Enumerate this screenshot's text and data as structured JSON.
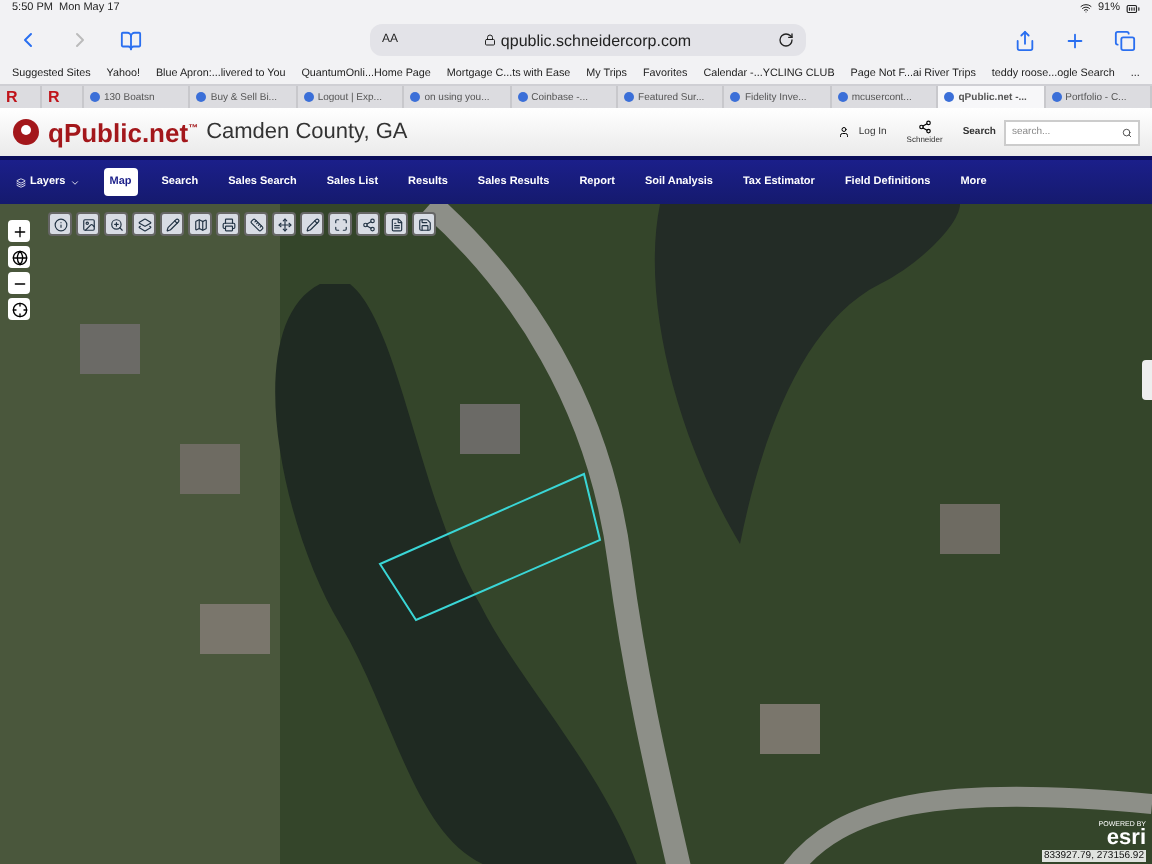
{
  "status_bar": {
    "time": "5:50 PM",
    "date": "Mon May 17",
    "battery": "91%"
  },
  "browser_toolbar": {
    "text_size": "AA",
    "url": "qpublic.schneidercorp.com"
  },
  "bookmarks": [
    "Suggested Sites",
    "Yahoo!",
    "Blue Apron:...livered to You",
    "QuantumOnli...Home Page",
    "Mortgage C...ts with Ease",
    "My Trips",
    "Favorites",
    "Calendar -...YCLING CLUB",
    "Page Not F...ai River Trips",
    "teddy roose...ogle Search",
    "..."
  ],
  "tabs": [
    {
      "kind": "pinned",
      "label": "R",
      "selected": false
    },
    {
      "kind": "pinned",
      "label": "R",
      "selected": false
    },
    {
      "kind": "tab",
      "label": "130 Boatsn",
      "selected": false
    },
    {
      "kind": "tab",
      "label": "Buy & Sell Bi...",
      "selected": false
    },
    {
      "kind": "tab",
      "label": "Logout | Exp...",
      "selected": false
    },
    {
      "kind": "tab",
      "label": "on using you...",
      "selected": false
    },
    {
      "kind": "tab",
      "label": "Coinbase -...",
      "selected": false
    },
    {
      "kind": "tab",
      "label": "Featured Sur...",
      "selected": false
    },
    {
      "kind": "tab",
      "label": "Fidelity Inve...",
      "selected": false
    },
    {
      "kind": "tab",
      "label": "mcusercont...",
      "selected": false
    },
    {
      "kind": "tab",
      "label": "qPublic.net -...",
      "selected": true
    },
    {
      "kind": "tab",
      "label": "Portfolio - C...",
      "selected": false
    }
  ],
  "site_header": {
    "logo": "qPublic.net",
    "trademark": "™",
    "county": "Camden County, GA",
    "login": "Log In",
    "schneider": "Schneider",
    "search_label": "Search",
    "search_placeholder": "search..."
  },
  "nav": {
    "layers": "Layers",
    "items": [
      {
        "label": "Map",
        "selected": true
      },
      {
        "label": "Search",
        "selected": false
      },
      {
        "label": "Sales Search",
        "selected": false
      },
      {
        "label": "Sales List",
        "selected": false
      },
      {
        "label": "Results",
        "selected": false
      },
      {
        "label": "Sales Results",
        "selected": false
      },
      {
        "label": "Report",
        "selected": false
      },
      {
        "label": "Soil Analysis",
        "selected": false
      },
      {
        "label": "Tax Estimator",
        "selected": false
      },
      {
        "label": "Field Definitions",
        "selected": false
      },
      {
        "label": "More",
        "selected": false
      }
    ]
  },
  "map": {
    "powered_by": "POWERED BY",
    "esri": "esri",
    "coordinates": "833927.79, 273156.92"
  }
}
